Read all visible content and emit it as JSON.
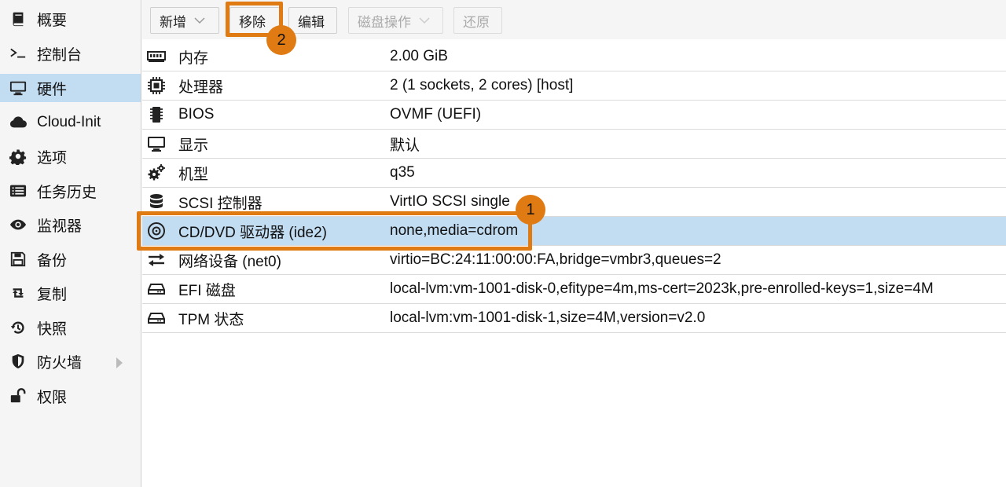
{
  "sidebar": {
    "items": [
      {
        "label": "概要",
        "icon": "book-icon"
      },
      {
        "label": "控制台",
        "icon": "terminal-icon"
      },
      {
        "label": "硬件",
        "icon": "monitor-icon",
        "active": true
      },
      {
        "label": "Cloud-Init",
        "icon": "cloud-icon"
      },
      {
        "label": "选项",
        "icon": "gear-icon"
      },
      {
        "label": "任务历史",
        "icon": "list-icon"
      },
      {
        "label": "监视器",
        "icon": "eye-icon"
      },
      {
        "label": "备份",
        "icon": "floppy-icon"
      },
      {
        "label": "复制",
        "icon": "retweet-icon"
      },
      {
        "label": "快照",
        "icon": "history-icon"
      },
      {
        "label": "防火墙",
        "icon": "shield-icon",
        "has_submenu": true
      },
      {
        "label": "权限",
        "icon": "unlock-icon"
      }
    ]
  },
  "toolbar": {
    "add_label": "新增",
    "remove_label": "移除",
    "edit_label": "编辑",
    "disk_action_label": "磁盘操作",
    "revert_label": "还原"
  },
  "hardware": {
    "rows": [
      {
        "name": "内存",
        "value": "2.00 GiB",
        "icon": "memory-icon"
      },
      {
        "name": "处理器",
        "value": "2 (1 sockets, 2 cores) [host]",
        "icon": "cpu-icon"
      },
      {
        "name": "BIOS",
        "value": "OVMF (UEFI)",
        "icon": "chip-icon"
      },
      {
        "name": "显示",
        "value": "默认",
        "icon": "monitor-icon"
      },
      {
        "name": "机型",
        "value": "q35",
        "icon": "cogs-icon"
      },
      {
        "name": "SCSI 控制器",
        "value": "VirtIO SCSI single",
        "icon": "database-icon"
      },
      {
        "name": "CD/DVD 驱动器 (ide2)",
        "value": "none,media=cdrom",
        "icon": "disc-icon",
        "selected": true
      },
      {
        "name": "网络设备 (net0)",
        "value": "virtio=BC:24:11:00:00:FA,bridge=vmbr3,queues=2",
        "icon": "exchange-icon"
      },
      {
        "name": "EFI 磁盘",
        "value": "local-lvm:vm-1001-disk-0,efitype=4m,ms-cert=2023k,pre-enrolled-keys=1,size=4M",
        "icon": "hdd-icon"
      },
      {
        "name": "TPM 状态",
        "value": "local-lvm:vm-1001-disk-1,size=4M,version=v2.0",
        "icon": "hdd-icon"
      }
    ]
  },
  "annotations": {
    "step1": "1",
    "step2": "2",
    "color": "#e07b14"
  },
  "colors": {
    "selection": "#c2dcf2",
    "sidebar_bg": "#f5f5f5"
  }
}
